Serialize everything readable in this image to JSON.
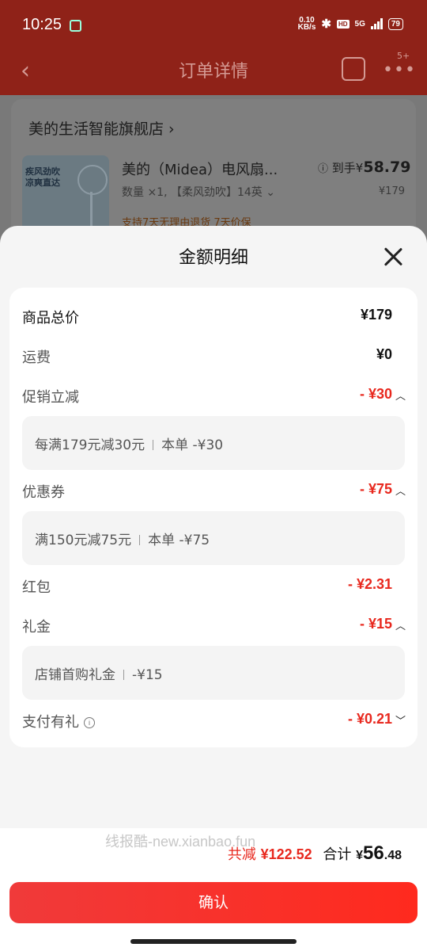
{
  "status_bar": {
    "time": "10:25",
    "net_speed_value": "0.10",
    "net_speed_unit": "KB/s",
    "hd": "HD",
    "signal": "5G",
    "battery": "79"
  },
  "nav": {
    "back_glyph": "‹",
    "title": "订单详情",
    "more_badge": "5+"
  },
  "order": {
    "store_name": "美的生活智能旗舰店 ›",
    "product_name": "美的（Midea）电风扇...",
    "price_label": "到手¥",
    "price_value": "58.79",
    "orig_price": "¥179",
    "spec": "数量 ×1, 【柔风劲吹】14英 ⌄",
    "service": "支持7天无理由退货   7天价保",
    "thumb_text": "疾风劲吹\n凉爽直达"
  },
  "sheet": {
    "title": "金额明细",
    "rows": {
      "total": {
        "label": "商品总价",
        "value": "¥179"
      },
      "shipping": {
        "label": "运费",
        "value": "¥0"
      },
      "promo": {
        "label": "促销立减",
        "value": "- ¥30",
        "detail_left": "每满179元减30元",
        "detail_right": "本单 -¥30"
      },
      "coupon": {
        "label": "优惠券",
        "value": "- ¥75",
        "detail_left": "满150元减75元",
        "detail_right": "本单 -¥75"
      },
      "redpacket": {
        "label": "红包",
        "value": "- ¥2.31"
      },
      "gift": {
        "label": "礼金",
        "value": "- ¥15",
        "detail_left": "店铺首购礼金",
        "detail_right": "-¥15"
      },
      "pay": {
        "label": "支付有礼",
        "value": "- ¥0.21"
      }
    }
  },
  "watermark": "线报酷-new.xianbao.fun",
  "summary": {
    "discount_label": "共减",
    "discount_value": "¥122.52",
    "total_label": "合计",
    "currency": "¥",
    "total_int": "56",
    "total_dec": ".48"
  },
  "confirm_label": "确认",
  "colors": {
    "accent_red": "#e8281e",
    "button_gradient_start": "#f03a3a",
    "button_gradient_end": "#ff2a1e"
  }
}
